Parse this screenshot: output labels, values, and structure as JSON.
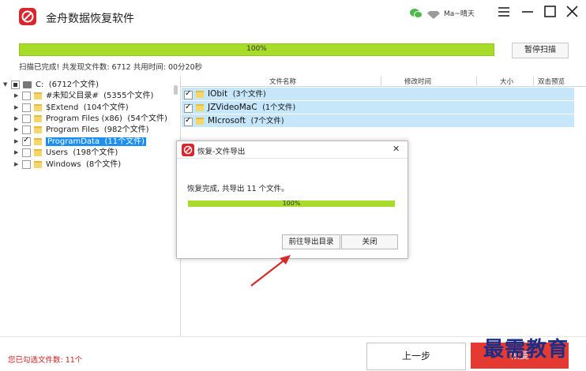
{
  "app": {
    "title": "金舟数据恢复软件",
    "user": "Ma~晴天"
  },
  "scan": {
    "progress_text": "100%",
    "pause_label": "暂停扫描",
    "status": "扫描已完成! 共发现文件数: 6712  共用时间: 00分20秒"
  },
  "tree": {
    "root": {
      "label": "C:",
      "count": "(6712个文件)"
    },
    "items": [
      {
        "label": "#未知父目录#",
        "count": "(5355个文件)"
      },
      {
        "label": "$Extend",
        "count": "(104个文件)"
      },
      {
        "label": "Program Files (x86)",
        "count": "(54个文件)"
      },
      {
        "label": "Program Files",
        "count": "(982个文件)"
      },
      {
        "label": "ProgramData",
        "count": "(11个文件)"
      },
      {
        "label": "Users",
        "count": "(198个文件)"
      },
      {
        "label": "Windows",
        "count": "(8个文件)"
      }
    ]
  },
  "table": {
    "headers": {
      "name": "文件名称",
      "modified": "修改时间",
      "size": "大小",
      "preview": "双击预览"
    },
    "rows": [
      {
        "name": "IObit",
        "count": "(3个文件)"
      },
      {
        "name": "JZVideoMaC",
        "count": "(1个文件)"
      },
      {
        "name": "MIcrosoft",
        "count": "(7个文件)"
      }
    ]
  },
  "dialog": {
    "title": "恢复-文件导出",
    "message": "恢复完成, 共导出 11 个文件。",
    "progress_text": "100%",
    "open_dir_label": "前往导出目录",
    "close_label": "关闭"
  },
  "footer": {
    "selected_count": "您已勾选文件数: 11个",
    "prev_label": "上一步",
    "recover_label": "恢复"
  },
  "watermark": "最需教育",
  "colors": {
    "accent_red": "#e43a32",
    "progress_green": "#a8dc2a",
    "selection_blue": "#1e8ff2",
    "row_highlight": "#c6e6fa"
  }
}
